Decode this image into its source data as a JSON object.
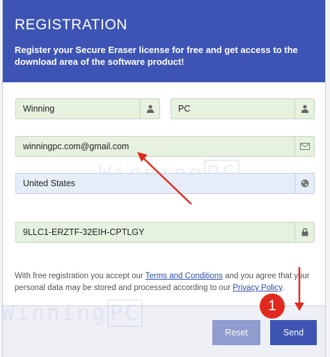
{
  "header": {
    "title": "REGISTRATION",
    "subtitle": "Register your Secure Eraser license for free and get access to the download area of the software product!"
  },
  "form": {
    "first_name": "Winning",
    "last_name": "PC",
    "email": "winningpc.com@gmail.com",
    "country": "United States",
    "license_key": "9LLC1-ERZTF-32EIH-CPTLGY"
  },
  "watermark": {
    "part1": "Winning",
    "part2": "PC"
  },
  "terms": {
    "text1": "With free registration you accept our ",
    "link1": "Terms and Conditions",
    "text2": " and you agree that your personal data may be stored and processed according to our ",
    "link2": "Privacy Policy",
    "text3": "."
  },
  "buttons": {
    "reset": "Reset",
    "send": "Send"
  },
  "annotation": {
    "step": "1",
    "color": "#e02a1f"
  },
  "colors": {
    "header": "#3e54b4",
    "send": "#3d54b2",
    "reset": "#8f9ccd",
    "field_green": "#e6f1df",
    "field_blue": "#e7edf8"
  },
  "icons": {
    "name_fields": "user-icon",
    "email": "envelope-icon",
    "country": "globe-icon",
    "license": "lock-icon"
  }
}
